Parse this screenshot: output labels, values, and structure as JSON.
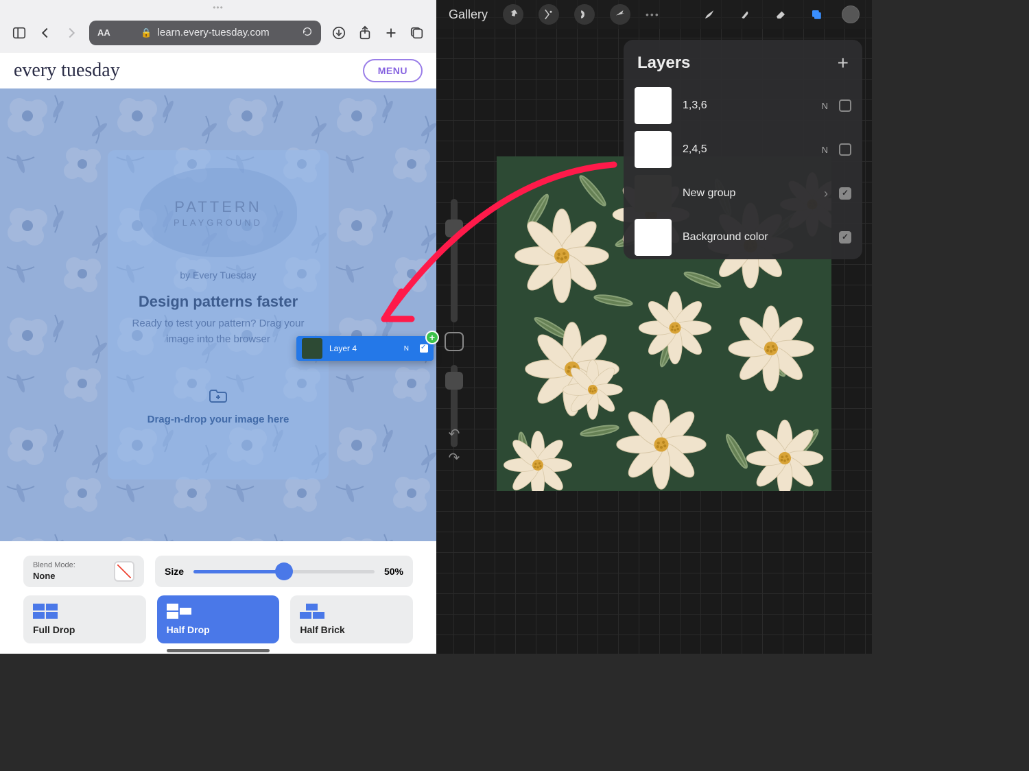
{
  "safari": {
    "url": "learn.every-tuesday.com",
    "aa": "AA"
  },
  "site": {
    "logo": "every tuesday",
    "menu": "MENU",
    "card": {
      "logo_line1": "PATTERN",
      "logo_line2": "PLAYGROUND",
      "by": "by Every Tuesday",
      "headline": "Design patterns faster",
      "sub": "Ready to test your pattern? Drag your image into the browser",
      "drop_label": "Drag-n-drop your image here"
    },
    "controls": {
      "blend_label": "Blend Mode:",
      "blend_value": "None",
      "size_label": "Size",
      "size_value": "50%",
      "buttons": [
        {
          "label": "Full Drop",
          "active": false
        },
        {
          "label": "Half Drop",
          "active": true
        },
        {
          "label": "Half Brick",
          "active": false
        }
      ]
    }
  },
  "drag": {
    "label": "Layer 4",
    "blend": "N"
  },
  "procreate": {
    "gallery": "Gallery",
    "layers_title": "Layers",
    "layers": [
      {
        "name": "1,3,6",
        "blend": "N",
        "checked": false,
        "thumb": "white"
      },
      {
        "name": "2,4,5",
        "blend": "N",
        "checked": false,
        "thumb": "white"
      },
      {
        "name": "New group",
        "blend": "",
        "checked": true,
        "thumb": "group",
        "chevron": true
      },
      {
        "name": "Background color",
        "blend": "",
        "checked": true,
        "thumb": "white"
      }
    ]
  }
}
